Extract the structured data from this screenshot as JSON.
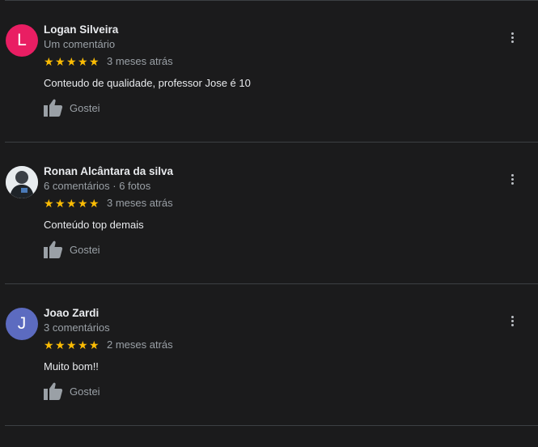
{
  "reviews": [
    {
      "avatar_letter": "L",
      "avatar_color": "#e91e63",
      "name": "Logan Silveira",
      "meta": "Um comentário",
      "rating": 5,
      "date": "3 meses atrás",
      "text": "Conteudo de qualidade, professor Jose é 10",
      "like_label": "Gostei"
    },
    {
      "avatar_letter": "",
      "avatar_color": "#dfe3e8",
      "name": "Ronan Alcântara da silva",
      "meta": "6 comentários · 6 fotos",
      "rating": 5,
      "date": "3 meses atrás",
      "text": "Conteúdo top demais",
      "like_label": "Gostei"
    },
    {
      "avatar_letter": "J",
      "avatar_color": "#5c6bc0",
      "name": "Joao Zardi",
      "meta": "3 comentários",
      "rating": 5,
      "date": "2 meses atrás",
      "text": "Muito bom!!",
      "like_label": "Gostei"
    }
  ],
  "icons": {
    "star": "★",
    "like": "thumbs-up-icon",
    "menu": "more-vert-icon"
  }
}
